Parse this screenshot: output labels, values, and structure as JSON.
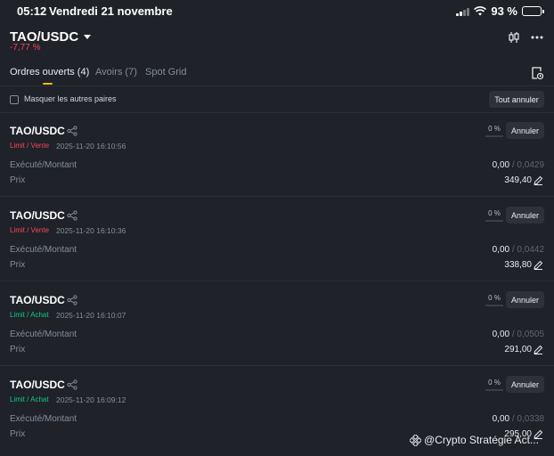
{
  "status_bar": {
    "time": "05:12",
    "date": "Vendredi 21 novembre",
    "battery": "93 %",
    "battery_level": 0.93
  },
  "header": {
    "pair": "TAO/USDC",
    "change": "-7,77 %"
  },
  "tabs": [
    {
      "label": "Ordres ouverts (4)",
      "active": true
    },
    {
      "label": "Avoirs (7)",
      "active": false
    },
    {
      "label": "Spot Grid",
      "active": false
    }
  ],
  "filter": {
    "label": "Masquer les autres paires",
    "cancel_all": "Tout annuler"
  },
  "labels": {
    "executed": "Exécuté/Montant",
    "price": "Prix",
    "cancel": "Annuler"
  },
  "orders": [
    {
      "pair": "TAO/USDC",
      "type": "Limit / Vente",
      "side": "sell",
      "date": "2025-11-20 16:10:56",
      "pct": "0 %",
      "progress": 0,
      "executed": "0,00",
      "amount": " / 0,0429",
      "price": "349,40"
    },
    {
      "pair": "TAO/USDC",
      "type": "Limit / Vente",
      "side": "sell",
      "date": "2025-11-20 16:10:36",
      "pct": "0 %",
      "progress": 0,
      "executed": "0,00",
      "amount": " / 0,0442",
      "price": "338,80"
    },
    {
      "pair": "TAO/USDC",
      "type": "Limit / Achat",
      "side": "buy",
      "date": "2025-11-20 16:10:07",
      "pct": "0 %",
      "progress": 0,
      "executed": "0,00",
      "amount": " / 0,0505",
      "price": "291,00"
    },
    {
      "pair": "TAO/USDC",
      "type": "Limit / Achat",
      "side": "buy",
      "date": "2025-11-20 16:09:12",
      "pct": "0 %",
      "progress": 0,
      "executed": "0,00",
      "amount": " / 0,0338",
      "price": "295,00"
    }
  ],
  "watermark": "@Crypto Stratégie Act...",
  "colors": {
    "background": "#1f2228",
    "accent": "#f0b90b",
    "sell": "#f6465d",
    "buy": "#0ecb81"
  }
}
